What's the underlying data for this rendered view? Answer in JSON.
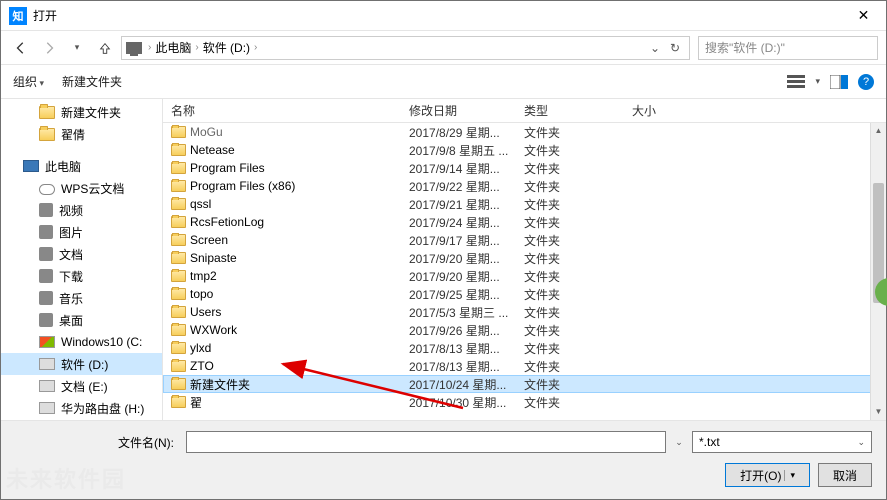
{
  "window": {
    "title": "打开",
    "app_icon_text": "知"
  },
  "nav": {
    "breadcrumb": [
      "此电脑",
      "软件 (D:)"
    ],
    "search_placeholder": "搜索\"软件 (D:)\""
  },
  "toolbar": {
    "organize": "组织",
    "new_folder": "新建文件夹"
  },
  "sidebar": {
    "top": [
      {
        "label": "新建文件夹",
        "icon": "folder"
      },
      {
        "label": "翟倩",
        "icon": "folder"
      }
    ],
    "pc_label": "此电脑",
    "pc_children": [
      {
        "label": "WPS云文档",
        "icon": "cloud"
      },
      {
        "label": "视频",
        "icon": "generic"
      },
      {
        "label": "图片",
        "icon": "generic"
      },
      {
        "label": "文档",
        "icon": "generic"
      },
      {
        "label": "下载",
        "icon": "generic"
      },
      {
        "label": "音乐",
        "icon": "generic"
      },
      {
        "label": "桌面",
        "icon": "generic"
      },
      {
        "label": "Windows10 (C:",
        "icon": "disk-win"
      },
      {
        "label": "软件 (D:)",
        "icon": "disk",
        "selected": true
      },
      {
        "label": "文档 (E:)",
        "icon": "disk"
      },
      {
        "label": "华为路由盘 (H:)",
        "icon": "disk"
      }
    ]
  },
  "columns": {
    "name": "名称",
    "date": "修改日期",
    "type": "类型",
    "size": "大小"
  },
  "files": [
    {
      "name": "MoGu",
      "date": "2017/8/29 星期...",
      "type": "文件夹",
      "cut": true
    },
    {
      "name": "Netease",
      "date": "2017/9/8 星期五 ...",
      "type": "文件夹"
    },
    {
      "name": "Program Files",
      "date": "2017/9/14 星期...",
      "type": "文件夹"
    },
    {
      "name": "Program Files (x86)",
      "date": "2017/9/22 星期...",
      "type": "文件夹"
    },
    {
      "name": "qssl",
      "date": "2017/9/21 星期...",
      "type": "文件夹"
    },
    {
      "name": "RcsFetionLog",
      "date": "2017/9/24 星期...",
      "type": "文件夹"
    },
    {
      "name": "Screen",
      "date": "2017/9/17 星期...",
      "type": "文件夹"
    },
    {
      "name": "Snipaste",
      "date": "2017/9/20 星期...",
      "type": "文件夹"
    },
    {
      "name": "tmp2",
      "date": "2017/9/20 星期...",
      "type": "文件夹"
    },
    {
      "name": "topo",
      "date": "2017/9/25 星期...",
      "type": "文件夹"
    },
    {
      "name": "Users",
      "date": "2017/5/3 星期三 ...",
      "type": "文件夹"
    },
    {
      "name": "WXWork",
      "date": "2017/9/26 星期...",
      "type": "文件夹"
    },
    {
      "name": "ylxd",
      "date": "2017/8/13 星期...",
      "type": "文件夹"
    },
    {
      "name": "ZTO",
      "date": "2017/8/13 星期...",
      "type": "文件夹"
    },
    {
      "name": "新建文件夹",
      "date": "2017/10/24 星期...",
      "type": "文件夹",
      "selected": true
    },
    {
      "name": "翟",
      "date": "2017/10/30 星期...",
      "type": "文件夹"
    }
  ],
  "footer": {
    "filename_label": "文件名(N):",
    "filter": "*.txt",
    "open_btn": "打开(O)",
    "cancel_btn": "取消"
  }
}
